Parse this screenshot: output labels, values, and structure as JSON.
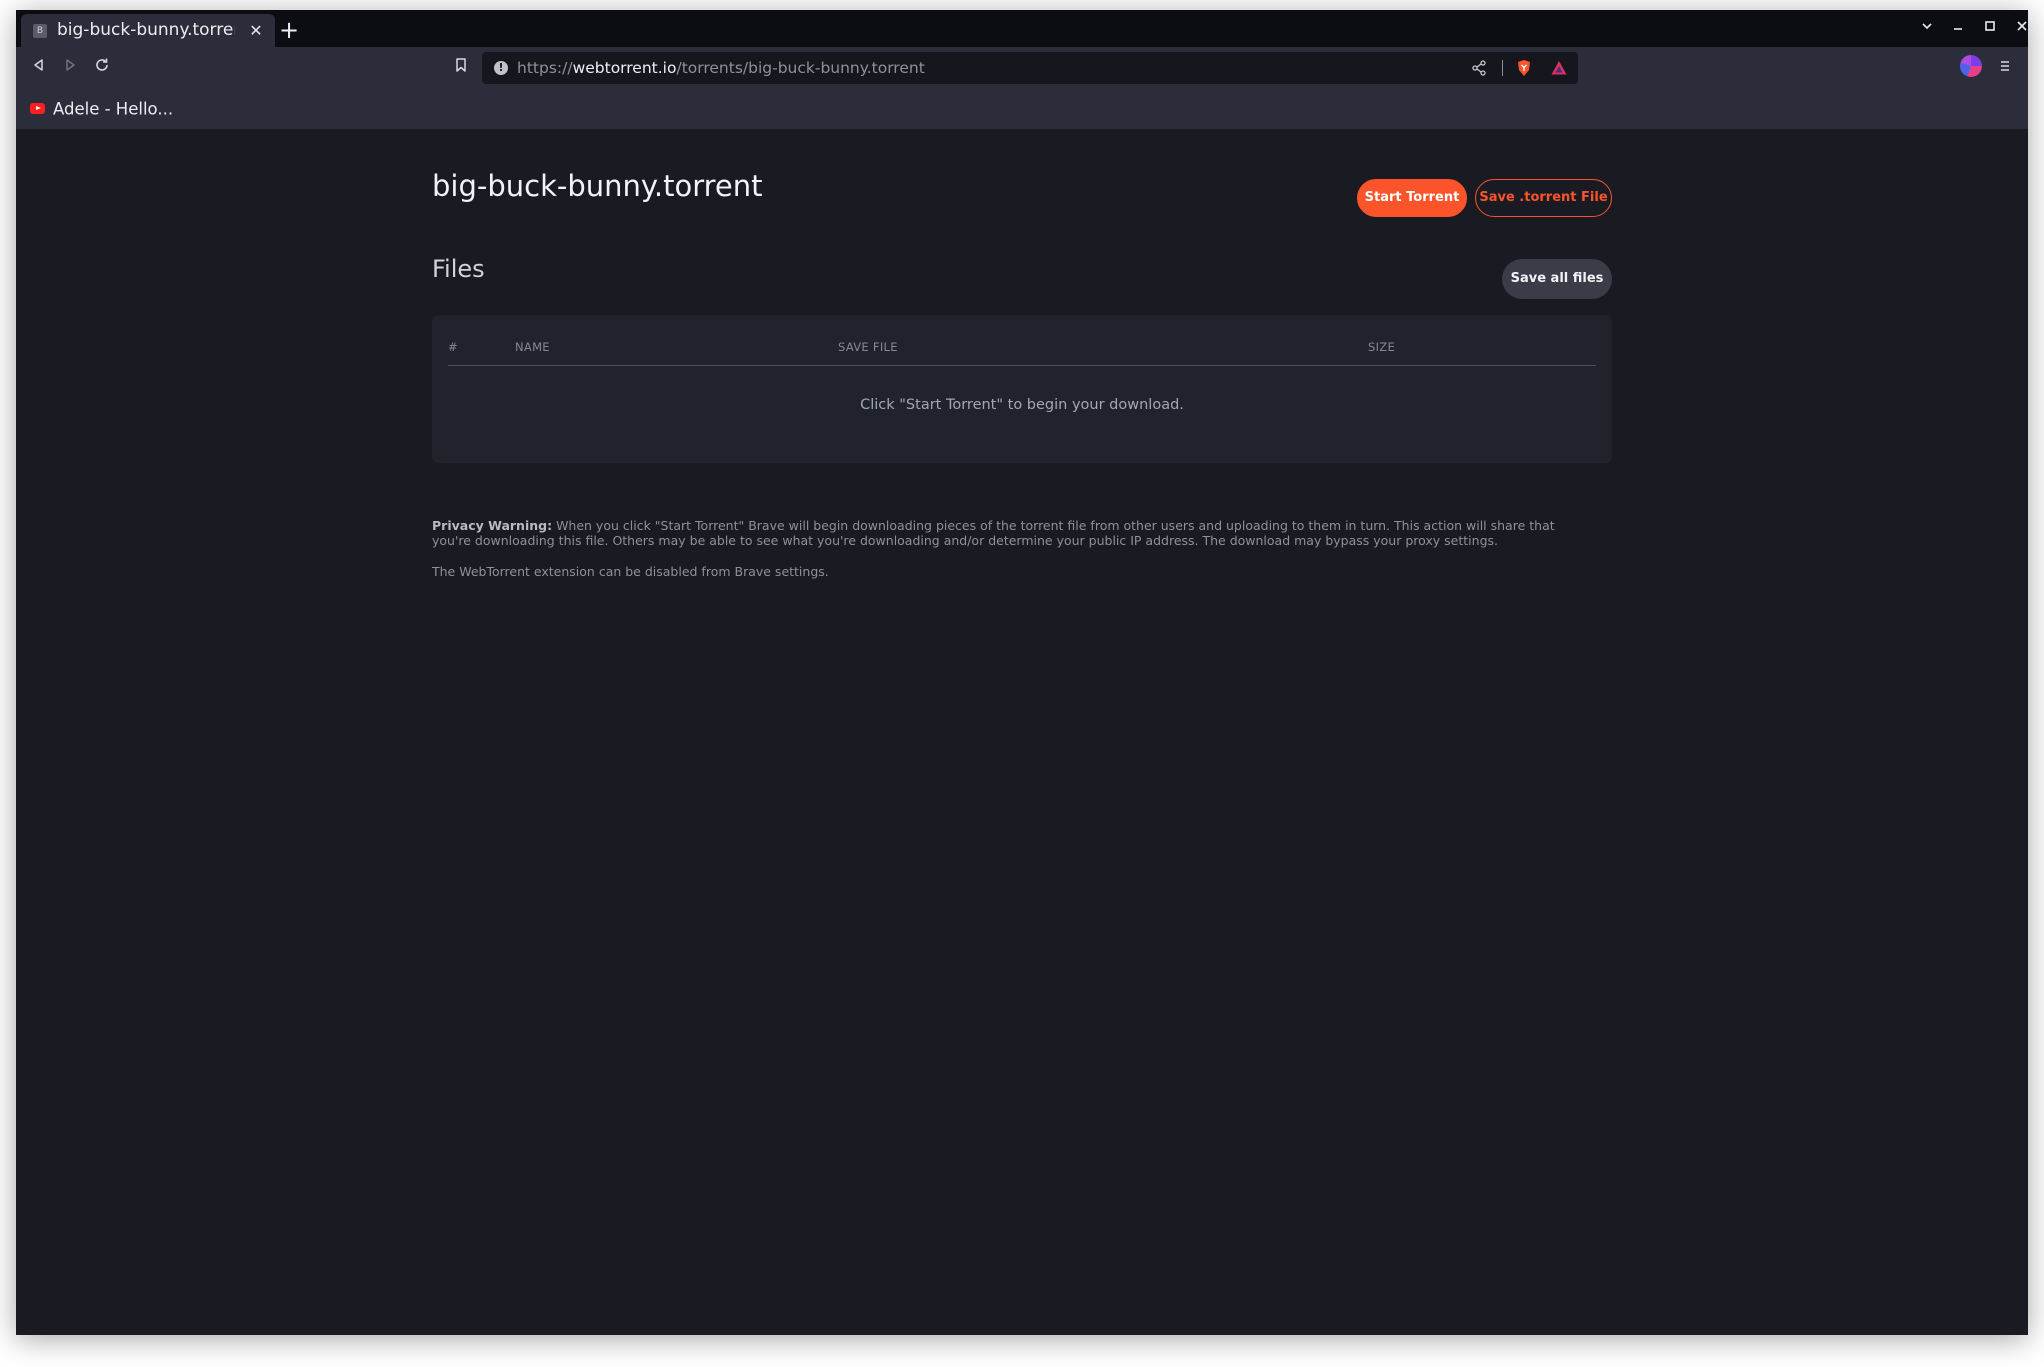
{
  "browser": {
    "tab": {
      "title": "big-buck-bunny.torrent",
      "favicon_letter": "B",
      "close_glyph": "✕"
    },
    "new_tab_glyph": "+",
    "address_bar": {
      "scheme": "https://",
      "host": "webtorrent.io",
      "path": "/torrents/big-buck-bunny.torrent"
    },
    "bookmarks": [
      {
        "label": "Adele - Hello..."
      }
    ],
    "icons": {
      "back": "back-triangle-icon",
      "forward": "forward-triangle-icon",
      "reload": "reload-icon",
      "bookmark": "bookmark-icon",
      "site_info": "info-icon",
      "share": "share-icon",
      "shields": "brave-shields-icon",
      "rewards": "brave-rewards-icon",
      "profile": "profile-avatar",
      "menu": "hamburger-menu-icon"
    }
  },
  "page": {
    "title": "big-buck-bunny.torrent",
    "start_button": "Start Torrent",
    "save_torrent_button": "Save .torrent File",
    "files_heading": "Files",
    "save_all_button": "Save all files",
    "table": {
      "columns": [
        "#",
        "NAME",
        "SAVE FILE",
        "SIZE"
      ],
      "empty_message": "Click \"Start Torrent\" to begin your download."
    },
    "privacy": {
      "label": "Privacy Warning:",
      "text": "When you click \"Start Torrent\" Brave will begin downloading pieces of the torrent file from other users and uploading to them in turn. This action will share that you're downloading this file. Others may be able to see what you're downloading and/or determine your public IP address. The download may bypass your proxy settings."
    },
    "extension_note": "The WebTorrent extension can be disabled from Brave settings."
  },
  "colors": {
    "accent": "#fb542b",
    "page_bg": "#191a22",
    "panel_bg": "#21232c",
    "toolbar_bg": "#2b2e3a",
    "tabstrip_bg": "#0c0d12"
  }
}
